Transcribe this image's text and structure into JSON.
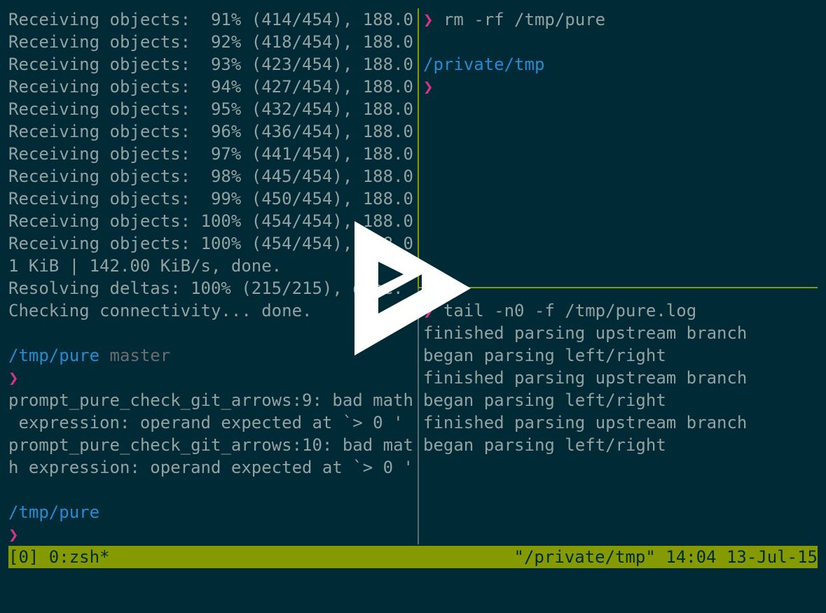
{
  "left_pane": {
    "lines": [
      "Receiving objects:  91% (414/454), 188.0",
      "Receiving objects:  92% (418/454), 188.0",
      "Receiving objects:  93% (423/454), 188.0",
      "Receiving objects:  94% (427/454), 188.0",
      "Receiving objects:  95% (432/454), 188.0",
      "Receiving objects:  96% (436/454), 188.0",
      "Receiving objects:  97% (441/454), 188.0",
      "Receiving objects:  98% (445/454), 188.0",
      "Receiving objects:  99% (450/454), 188.0",
      "Receiving objects: 100% (454/454), 188.0",
      "Receiving objects: 100% (454/454), 188.0",
      "1 KiB | 142.00 KiB/s, done.",
      "Resolving deltas: 100% (215/215), done.",
      "Checking connectivity... done.",
      ""
    ],
    "prompt1_path": "/tmp/pure",
    "prompt1_branch": "master",
    "prompt_symbol": "❯",
    "error_lines": [
      "prompt_pure_check_git_arrows:9: bad math",
      " expression: operand expected at `> 0 '",
      "prompt_pure_check_git_arrows:10: bad mat",
      "h expression: operand expected at `> 0 '",
      ""
    ],
    "prompt2_path": "/tmp/pure"
  },
  "right_top": {
    "command": "rm -rf /tmp/pure",
    "cwd": "/private/tmp"
  },
  "right_bottom": {
    "command": "tail -n0 -f /tmp/pure.log",
    "log_lines": [
      "finished parsing upstream branch",
      "began parsing left/right",
      "finished parsing upstream branch",
      "began parsing left/right",
      "finished parsing upstream branch",
      "began parsing left/right"
    ]
  },
  "status_bar": {
    "left": "[0] 0:zsh*",
    "right": "\"/private/tmp\" 14:04 13-Jul-15"
  },
  "overlay": {
    "icon": "play-icon"
  },
  "colors": {
    "background": "#002b36",
    "text": "#93a1a1",
    "path": "#268bd2",
    "prompt_symbol": "#d33682",
    "branch": "#6c6c6c",
    "status_bar_bg": "#859900",
    "active_border": "#859900"
  }
}
